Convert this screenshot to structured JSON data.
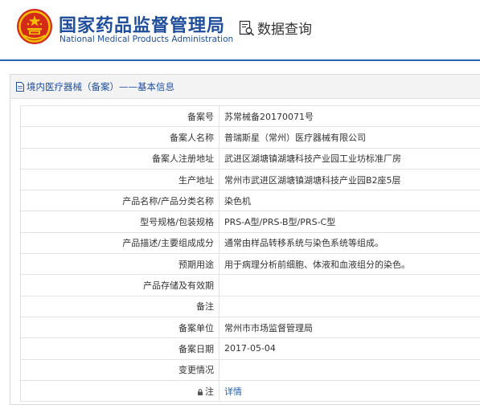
{
  "header": {
    "org_name_cn": "国家药品监督管理局",
    "org_name_en": "National Medical Products Administration",
    "query_title": "数据查询"
  },
  "panel": {
    "title": "境内医疗器械（备案）——基本信息"
  },
  "rows": [
    {
      "label": "备案号",
      "value": "苏常械备20170071号"
    },
    {
      "label": "备案人名称",
      "value": "普瑞斯星（常州）医疗器械有限公司"
    },
    {
      "label": "备案人注册地址",
      "value": "武进区湖塘镇湖塘科技产业园工业坊标准厂房"
    },
    {
      "label": "生产地址",
      "value": "常州市武进区湖塘镇湖塘科技产业园B2座5层"
    },
    {
      "label": "产品名称/产品分类名称",
      "value": "染色机"
    },
    {
      "label": "型号规格/包装规格",
      "value": "PRS-A型/PRS-B型/PRS-C型"
    },
    {
      "label": "产品描述/主要组成成分",
      "value": "通常由样品转移系统与染色系统等组成。"
    },
    {
      "label": "预期用途",
      "value": "用于病理分析前细胞、体液和血液组分的染色。"
    },
    {
      "label": "产品存储及有效期",
      "value": ""
    },
    {
      "label": "备注",
      "value": ""
    },
    {
      "label": "备案单位",
      "value": "常州市市场监督管理局"
    },
    {
      "label": "备案日期",
      "value": "2017-05-04"
    },
    {
      "label": "变更情况",
      "value": ""
    },
    {
      "label": "注",
      "value": "详情"
    }
  ],
  "colors": {
    "brand_blue": "#1f4e9c",
    "link_blue": "#2a60b0",
    "emblem_red": "#d42a1c",
    "emblem_gold": "#f2c200"
  },
  "icons": {
    "emblem": "national-emblem-icon",
    "query": "search-document-icon",
    "panel": "document-icon",
    "note": "lock-icon"
  }
}
